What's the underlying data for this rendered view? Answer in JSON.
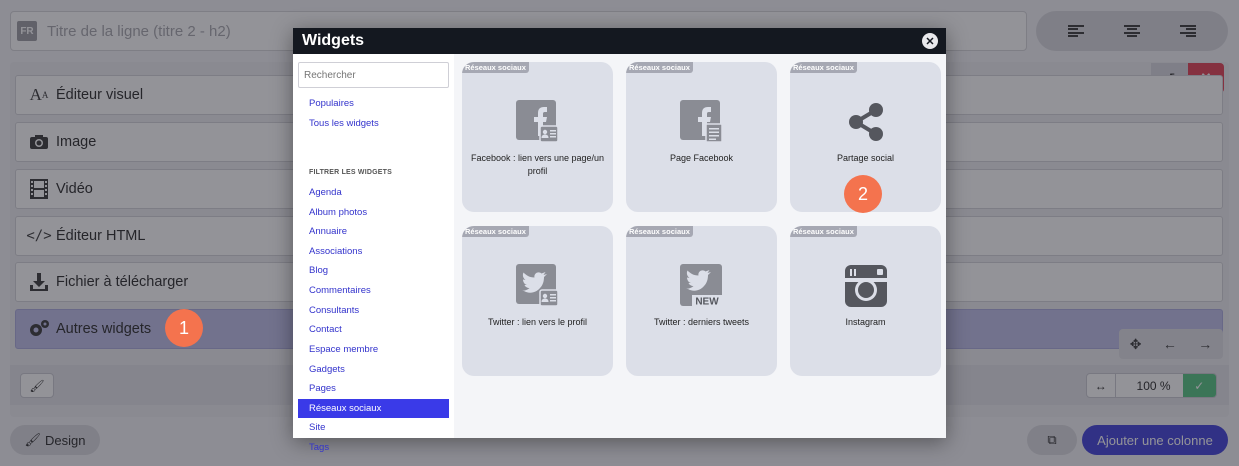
{
  "background": {
    "title_input": {
      "lang": "FR",
      "placeholder": "Titre de la ligne (titre 2 - h2)"
    },
    "widget_rows": [
      {
        "label": "Éditeur visuel",
        "icon": "text-a-icon"
      },
      {
        "label": "Image",
        "icon": "camera-icon"
      },
      {
        "label": "Vidéo",
        "icon": "film-icon"
      },
      {
        "label": "Éditeur HTML",
        "icon": "code-icon"
      },
      {
        "label": "Fichier à télécharger",
        "icon": "download-icon"
      },
      {
        "label": "Autres widgets",
        "icon": "gears-icon"
      }
    ],
    "width_value": "100 %",
    "design_label": "Design",
    "add_column_label": "Ajouter une colonne"
  },
  "callouts": {
    "one": "1",
    "two": "2"
  },
  "modal": {
    "title": "Widgets",
    "search_placeholder": "Rechercher",
    "top_links": [
      "Populaires",
      "Tous les widgets"
    ],
    "filter_heading": "FILTRER LES WIDGETS",
    "categories": [
      "Agenda",
      "Album photos",
      "Annuaire",
      "Associations",
      "Blog",
      "Commentaires",
      "Consultants",
      "Contact",
      "Espace membre",
      "Gadgets",
      "Pages",
      "Réseaux sociaux",
      "Site",
      "Tags"
    ],
    "active_category": "Réseaux sociaux",
    "cards": [
      {
        "tag": "Réseaux sociaux",
        "label": "Facebook : lien vers une page/un profil",
        "icon": "facebook-profile-icon"
      },
      {
        "tag": "Réseaux sociaux",
        "label": "Page Facebook",
        "icon": "facebook-page-icon"
      },
      {
        "tag": "Réseaux sociaux",
        "label": "Partage social",
        "icon": "share-icon"
      },
      {
        "tag": "Réseaux sociaux",
        "label": "Twitter : lien vers le profil",
        "icon": "twitter-profile-icon"
      },
      {
        "tag": "Réseaux sociaux",
        "label": "Twitter : derniers tweets",
        "icon": "twitter-new-icon"
      },
      {
        "tag": "Réseaux sociaux",
        "label": "Instagram",
        "icon": "instagram-icon"
      }
    ],
    "new_badge": "NEW"
  }
}
